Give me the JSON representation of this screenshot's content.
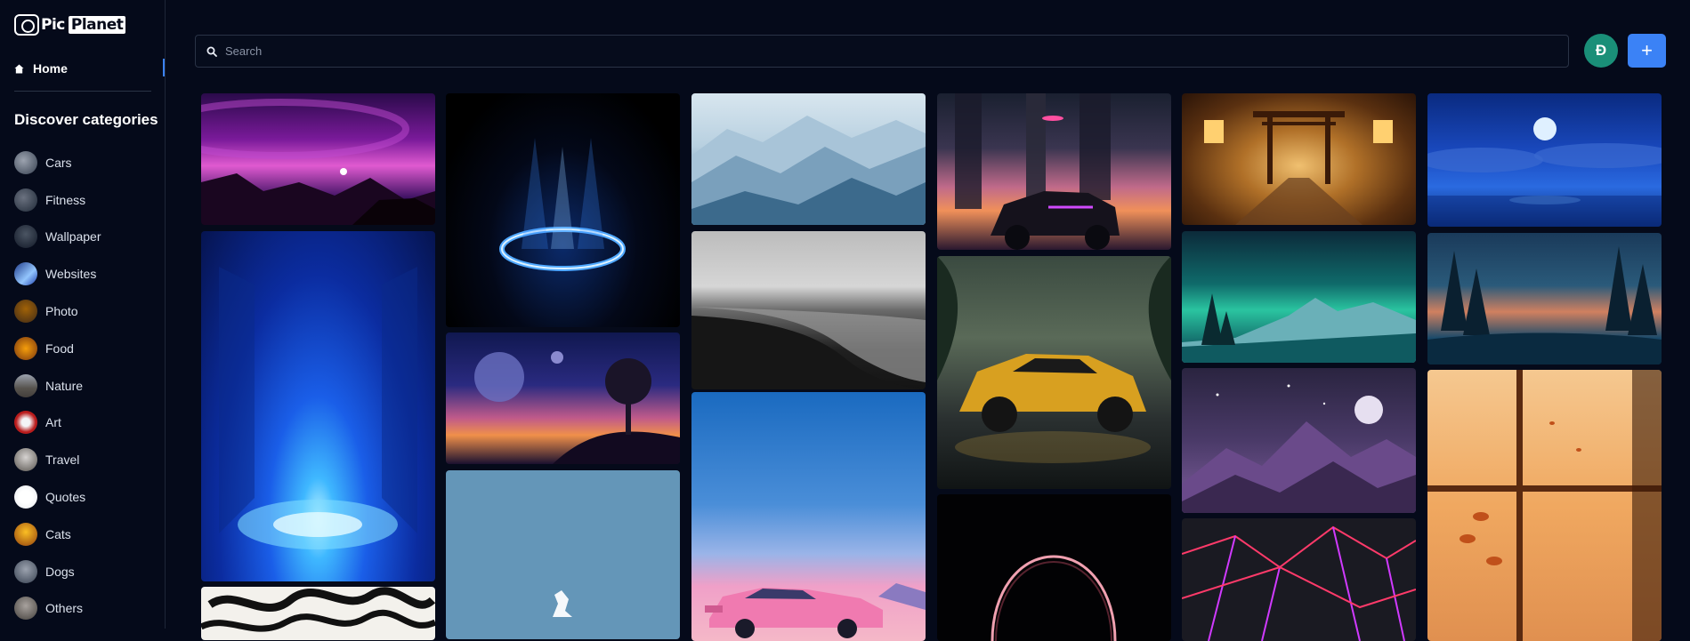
{
  "app": {
    "logo_word_1": "Pic",
    "logo_word_2": "Planet"
  },
  "sidebar": {
    "home_label": "Home",
    "discover_title": "Discover categories",
    "categories": [
      {
        "label": "Cars",
        "color": "#6b7280"
      },
      {
        "label": "Fitness",
        "color": "#4b5563"
      },
      {
        "label": "Wallpaper",
        "color": "#374151"
      },
      {
        "label": "Websites",
        "color": "#1e3a8a"
      },
      {
        "label": "Photo",
        "color": "#7c5a3a"
      },
      {
        "label": "Food",
        "color": "#b45309"
      },
      {
        "label": "Nature",
        "color": "#6b4f3a"
      },
      {
        "label": "Art",
        "color": "#b91c1c"
      },
      {
        "label": "Travel",
        "color": "#9ca3af"
      },
      {
        "label": "Quotes",
        "color": "#f3f4f6"
      },
      {
        "label": "Cats",
        "color": "#d97706"
      },
      {
        "label": "Dogs",
        "color": "#6b7280"
      },
      {
        "label": "Others",
        "color": "#78716c"
      }
    ]
  },
  "header": {
    "search_placeholder": "Search",
    "avatar_initial": "Đ",
    "add_label": "+"
  },
  "colors": {
    "accent": "#3b82f6",
    "avatar": "#1a8f78",
    "background": "#050a1a"
  },
  "images": [
    {
      "name": "purple-planet-landscape"
    },
    {
      "name": "blue-portal-ring"
    },
    {
      "name": "misty-blue-mountains"
    },
    {
      "name": "neon-city-supercar"
    },
    {
      "name": "japanese-torii-street"
    },
    {
      "name": "moonlit-ocean-clouds"
    },
    {
      "name": "blue-sci-fi-tunnel"
    },
    {
      "name": "sunset-planet-tree"
    },
    {
      "name": "black-sand-beach"
    },
    {
      "name": "yellow-supercar-jungle"
    },
    {
      "name": "teal-mountain-pines"
    },
    {
      "name": "forest-lake-sunset"
    },
    {
      "name": "black-white-brush-art"
    },
    {
      "name": "ferrari-logo-blue"
    },
    {
      "name": "retro-pink-sportscar"
    },
    {
      "name": "dark-glowing-arc"
    },
    {
      "name": "purple-mountains-moon"
    },
    {
      "name": "neon-geometric-shards"
    },
    {
      "name": "orange-window-leaves"
    }
  ]
}
